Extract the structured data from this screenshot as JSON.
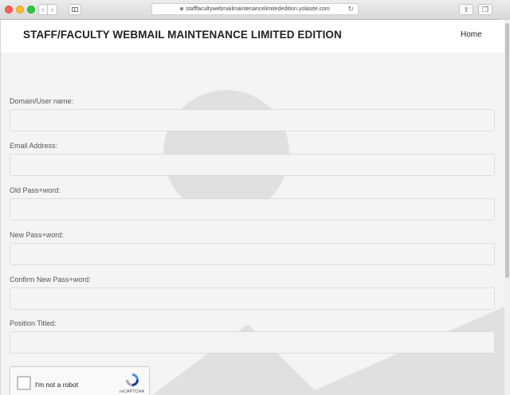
{
  "browser": {
    "url": "stafffacultywebmailmaintenancelimitededition.yolasite.com",
    "back_glyph": "‹",
    "forward_glyph": "›",
    "reload_glyph": "↻",
    "share_glyph": "⇪",
    "tabs_glyph": "❐",
    "new_tab_glyph": "+"
  },
  "site": {
    "title": "STAFF/FACULTY WEBMAIL MAINTENANCE LIMITED EDITION",
    "nav_home": "Home"
  },
  "form": {
    "fields": [
      {
        "label": "Domain/User name:",
        "value": ""
      },
      {
        "label": "Email Address:",
        "value": ""
      },
      {
        "label": "Old Pass+word:",
        "value": ""
      },
      {
        "label": "New Pass+word:",
        "value": ""
      },
      {
        "label": "Confirm New Pass+word:",
        "value": ""
      },
      {
        "label": "Position Titled:",
        "value": ""
      }
    ]
  },
  "captcha": {
    "label": "I'm not a robot",
    "brand": "reCAPTCHA",
    "checked": false
  },
  "colors": {
    "page_bg": "#f4f4f4",
    "header_bg": "#ffffff",
    "placeholder_shape": "#e0e0e0",
    "recaptcha_blue": "#4a90e2"
  }
}
